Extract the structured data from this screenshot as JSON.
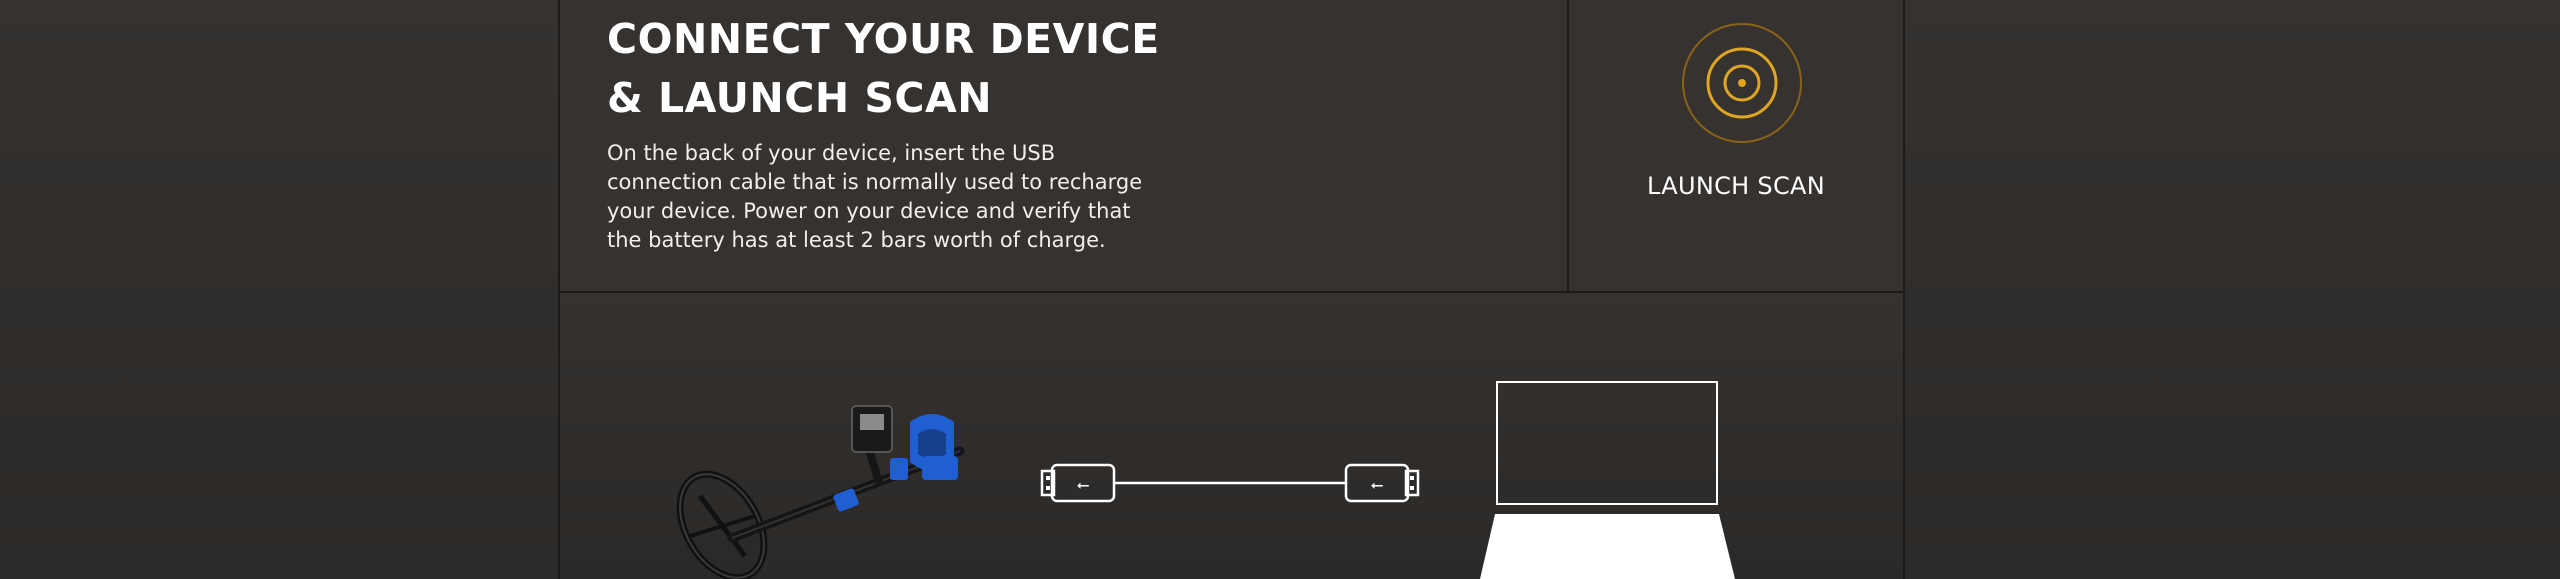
{
  "connect_section": {
    "title_line1": "CONNECT YOUR DEVICE",
    "title_line2": "& LAUNCH SCAN",
    "description": "On the back of your device, insert the USB connection cable that is normally used to recharge your device. Power on your device and verify that the battery has at least 2 bars worth of charge."
  },
  "launch_scan": {
    "label": "LAUNCH SCAN",
    "icon": "scan-target-icon",
    "accent_color": "#e0a521"
  },
  "illustration": {
    "items": [
      "metal-detector-icon",
      "usb-cable-icon",
      "laptop-icon"
    ],
    "detector_accent_color": "#1f5fd1"
  }
}
